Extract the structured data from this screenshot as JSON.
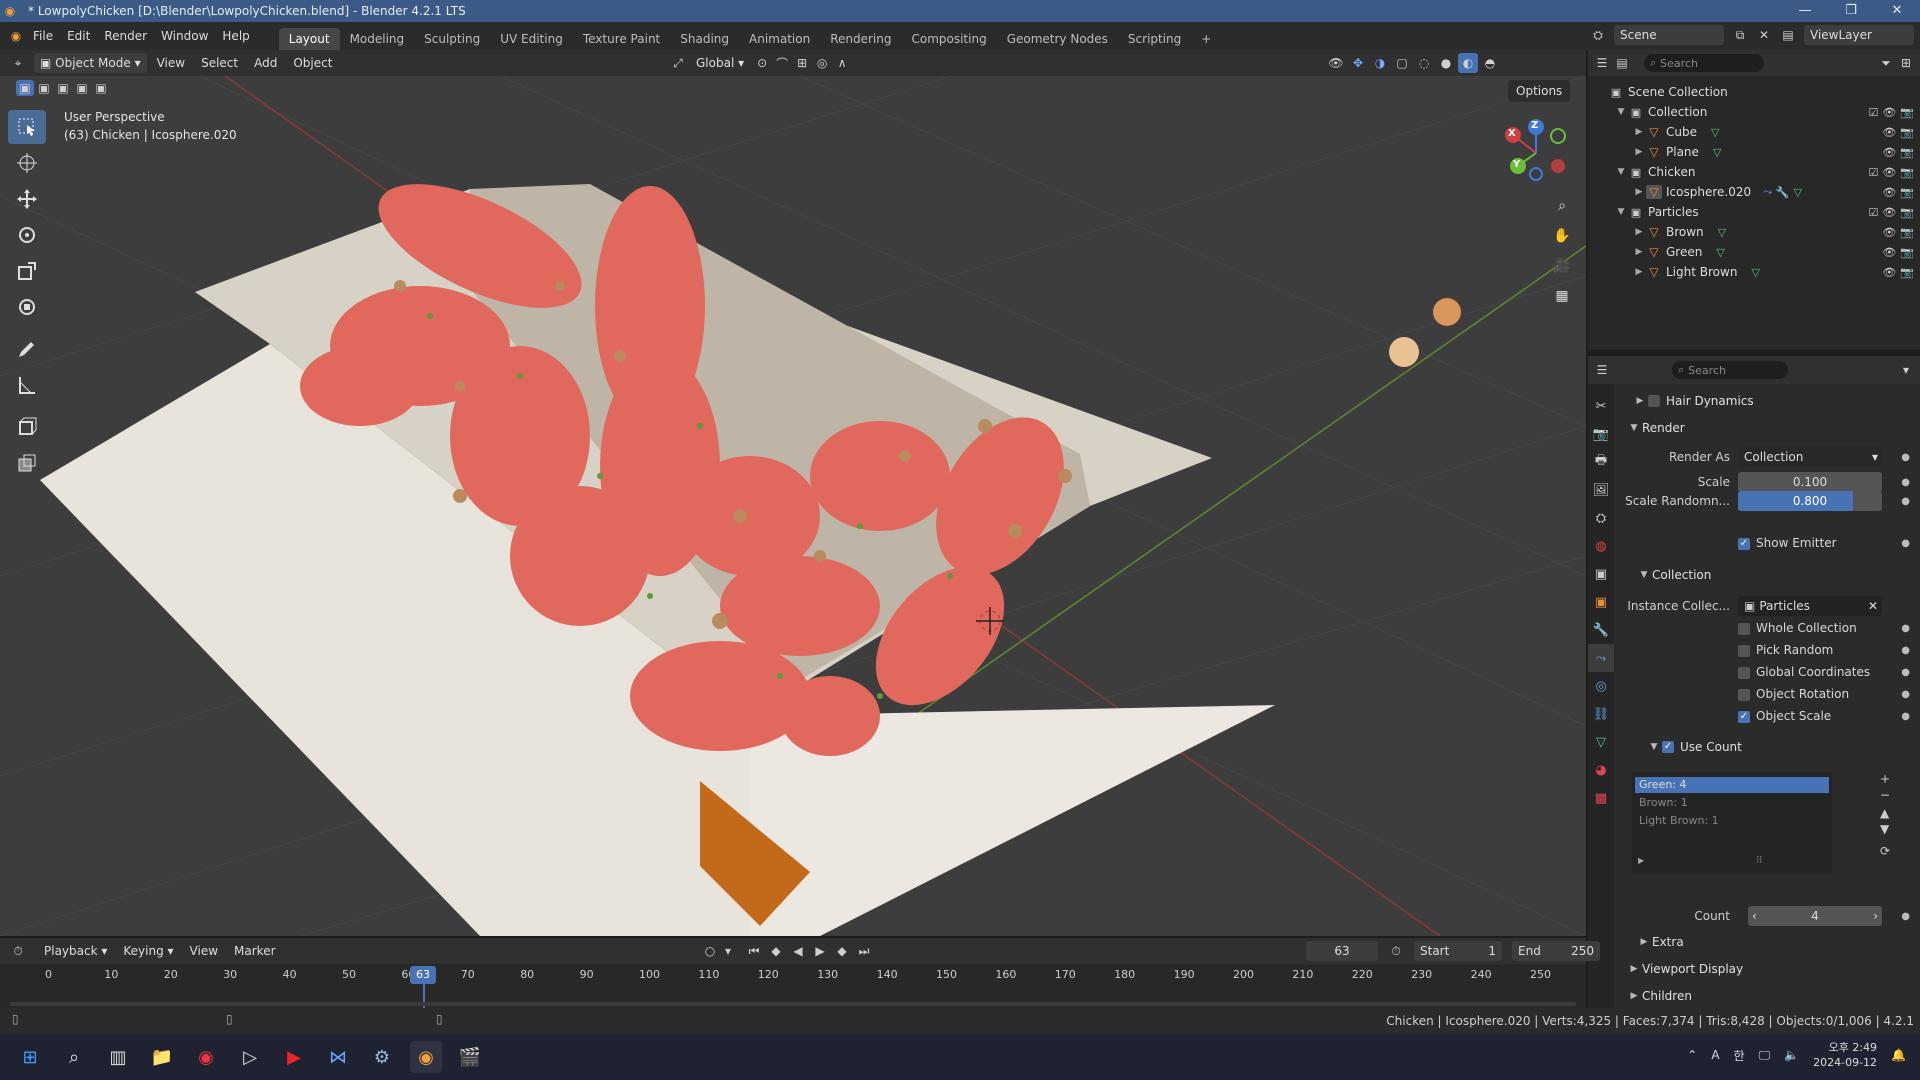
{
  "window": {
    "title": "* LowpolyChicken [D:\\Blender\\LowpolyChicken.blend] - Blender 4.2.1 LTS"
  },
  "menu": [
    "File",
    "Edit",
    "Render",
    "Window",
    "Help"
  ],
  "workspaces": [
    "Layout",
    "Modeling",
    "Sculpting",
    "UV Editing",
    "Texture Paint",
    "Shading",
    "Animation",
    "Rendering",
    "Compositing",
    "Geometry Nodes",
    "Scripting"
  ],
  "scene": {
    "label": "Scene",
    "viewlayer": "ViewLayer"
  },
  "viewport_header": {
    "mode": "Object Mode",
    "menus": [
      "View",
      "Select",
      "Add",
      "Object"
    ],
    "orientation": "Global",
    "options": "Options"
  },
  "viewport": {
    "perspective": "User Perspective",
    "object_info": "(63) Chicken | Icosphere.020"
  },
  "gizmo": {
    "x": "X",
    "y": "Y",
    "z": "Z"
  },
  "outliner": {
    "search_placeholder": "Search",
    "rows": [
      {
        "label": "Scene Collection",
        "kind": "scene",
        "depth": 0
      },
      {
        "label": "Collection",
        "kind": "collection",
        "depth": 1
      },
      {
        "label": "Cube",
        "kind": "object",
        "depth": 2
      },
      {
        "label": "Plane",
        "kind": "object",
        "depth": 2
      },
      {
        "label": "Chicken",
        "kind": "collection",
        "depth": 1
      },
      {
        "label": "Icosphere.020",
        "kind": "object",
        "depth": 2
      },
      {
        "label": "Particles",
        "kind": "collection",
        "depth": 1
      },
      {
        "label": "Brown",
        "kind": "object",
        "depth": 2
      },
      {
        "label": "Green",
        "kind": "object",
        "depth": 2
      },
      {
        "label": "Light Brown",
        "kind": "object",
        "depth": 2
      }
    ]
  },
  "properties": {
    "search_placeholder": "Search",
    "hair_dynamics": "Hair Dynamics",
    "render_panel": "Render",
    "render_as_label": "Render As",
    "render_as_value": "Collection",
    "scale_label": "Scale",
    "scale_value": "0.100",
    "scale_random_label": "Scale Randomn...",
    "scale_random_value": "0.800",
    "scale_random_fraction": 0.8,
    "show_emitter": "Show Emitter",
    "collection_panel": "Collection",
    "instance_label": "Instance Collec...",
    "instance_value": "Particles",
    "whole_collection": "Whole Collection",
    "pick_random": "Pick Random",
    "global_coordinates": "Global Coordinates",
    "object_rotation": "Object Rotation",
    "object_scale": "Object Scale",
    "use_count": "Use Count",
    "list_items": [
      "Green: 4",
      "Brown: 1",
      "Light Brown: 1"
    ],
    "count_label": "Count",
    "count_value": "4",
    "extra": "Extra",
    "viewport_display": "Viewport Display",
    "children": "Children"
  },
  "timeline": {
    "menus": [
      "Playback",
      "Keying",
      "View",
      "Marker"
    ],
    "current_frame": "63",
    "start_label": "Start",
    "start_value": "1",
    "end_label": "End",
    "end_value": "250",
    "ticks": [
      "0",
      "10",
      "20",
      "30",
      "40",
      "50",
      "60",
      "70",
      "80",
      "90",
      "100",
      "110",
      "120",
      "130",
      "140",
      "150",
      "160",
      "170",
      "180",
      "190",
      "200",
      "210",
      "220",
      "230",
      "240",
      "250"
    ]
  },
  "status": {
    "text": "Chicken | Icosphere.020 | Verts:4,325 | Faces:7,374 | Tris:8,428 | Objects:0/1,006 | 4.2.1"
  },
  "taskbar": {
    "lang": "A",
    "ime": "한",
    "time": "오후 2:49",
    "date": "2024-09-12"
  },
  "colors": {
    "accent": "#4772b3",
    "title_bar": "#3c5a86",
    "chicken": "#e0685c",
    "box": "#e8e4dc",
    "object_icon": "#e6913a",
    "mesh_icon": "#4fc97a"
  }
}
